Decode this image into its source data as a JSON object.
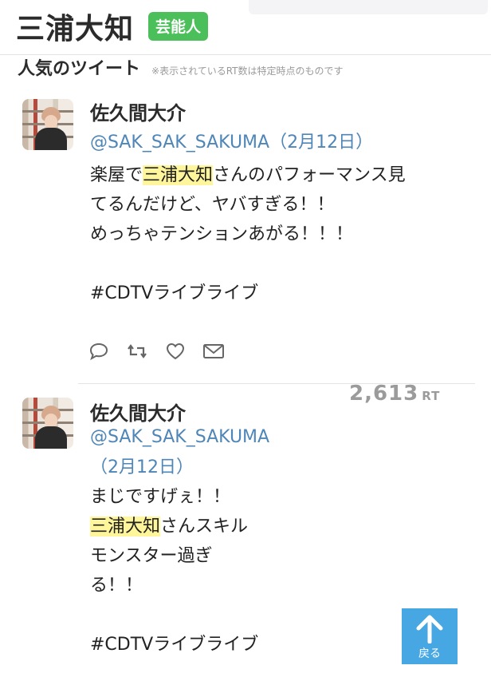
{
  "header": {
    "name": "三浦大知",
    "badge": "芸能人"
  },
  "section": {
    "title": "人気のツイート",
    "note": "※表示されているRT数は特定時点のものです"
  },
  "tweets": [
    {
      "user_name": "佐久間大介",
      "handle": "@SAK_SAK_SAKUMA（2月12日）",
      "lines": [
        {
          "pre": "楽屋で",
          "hl": "三浦大知",
          "post": "さんのパフォーマンス見"
        },
        {
          "pre": "てるんだけど、ヤバすぎる！！",
          "hl": "",
          "post": ""
        },
        {
          "pre": "めっちゃテンションあがる！！！",
          "hl": "",
          "post": ""
        },
        {
          "pre": "",
          "hl": "",
          "post": ""
        },
        {
          "pre": "#CDTVライブライブ",
          "hl": "",
          "post": ""
        }
      ]
    },
    {
      "user_name": "佐久間大介",
      "handle_line1": "@SAK_SAK_SAKUMA",
      "handle_line2": "（2月12日）",
      "rt_count": "2,613",
      "rt_unit": "RT",
      "lines": [
        {
          "pre": "まじですげぇ！！",
          "hl": "",
          "post": ""
        },
        {
          "pre": "",
          "hl": "三浦大知",
          "post": "さんスキル"
        },
        {
          "pre": "モンスター過ぎ",
          "hl": "",
          "post": ""
        },
        {
          "pre": "る！！",
          "hl": "",
          "post": ""
        },
        {
          "pre": "",
          "hl": "",
          "post": ""
        },
        {
          "pre": "#CDTVライブライブ",
          "hl": "",
          "post": ""
        }
      ]
    }
  ],
  "actions": [
    {
      "icon": "reply-icon"
    },
    {
      "icon": "retweet-icon"
    },
    {
      "icon": "like-icon"
    },
    {
      "icon": "mail-icon"
    }
  ],
  "back_button": {
    "label": "戻る"
  },
  "colors": {
    "badge": "#4bbf5a",
    "handle": "#4f86b8",
    "highlight": "#fff59a",
    "back_button": "#47a7e3",
    "rt_count": "#9b9b9b"
  }
}
